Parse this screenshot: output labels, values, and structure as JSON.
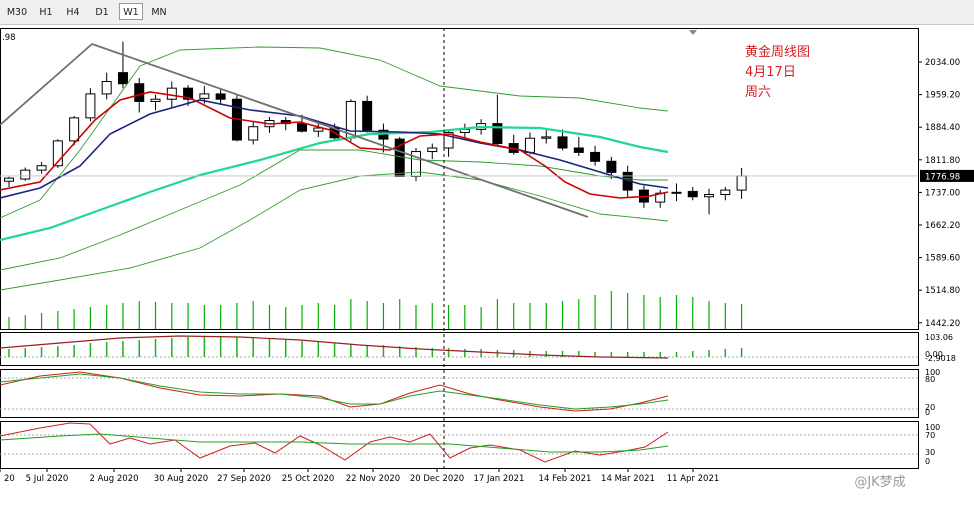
{
  "toolbar": {
    "timeframes": [
      "M30",
      "H1",
      "H4",
      "D1",
      "W1",
      "MN"
    ],
    "active_timeframe": "W1"
  },
  "chart_data": [
    {
      "type": "candlestick",
      "annotation_lines": [
        "黄金周线图",
        "4月17日",
        "周六"
      ],
      "top_left_partial_label": ".98",
      "current_price": "1776.98",
      "y_ticks": [
        "2034.00",
        "1959.20",
        "1884.40",
        "1811.80",
        "1737.00",
        "1662.20",
        "1589.60",
        "1514.80",
        "1442.20"
      ],
      "x_ticks": [
        "20",
        "5 Jul 2020",
        "2 Aug 2020",
        "30 Aug 2020",
        "27 Sep 2020",
        "25 Oct 2020",
        "22 Nov 2020",
        "20 Dec 2020",
        "17 Jan 2021",
        "14 Feb 2021",
        "14 Mar 2021",
        "11 Apr 2021"
      ],
      "colors": {
        "bull_body": "#ffffff",
        "bear_body": "#000000",
        "ma_fast": "#cc0000",
        "ma_slow": "#1a237e",
        "ma_long": "#20d890",
        "bollinger": "#2e9e2e",
        "volume": "#00b000",
        "trend_line": "#707070",
        "annotation": "#d42020"
      }
    },
    {
      "type": "line",
      "panel": "oscillator_1",
      "y_ticks": [
        "103.06",
        "0.00",
        "-2.9018"
      ],
      "series_colors": [
        "#9a2020",
        "#20b020"
      ]
    },
    {
      "type": "line",
      "panel": "oscillator_2",
      "y_ticks": [
        "100",
        "80",
        "20",
        "0"
      ],
      "series_colors": [
        "#cc2020",
        "#20a020"
      ]
    },
    {
      "type": "line",
      "panel": "oscillator_3",
      "y_ticks": [
        "100",
        "70",
        "30",
        "0"
      ],
      "series_colors": [
        "#cc2020",
        "#20a020"
      ]
    }
  ],
  "watermark": "@JK梦成"
}
